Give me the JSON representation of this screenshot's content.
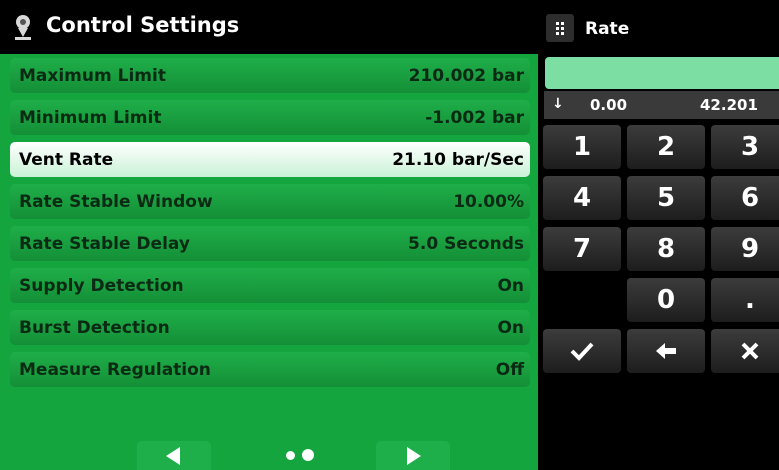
{
  "header": {
    "icon": "location-pin-icon",
    "title": "Control Settings"
  },
  "settings": [
    {
      "label": "Maximum Limit",
      "value": "210.002 bar",
      "selected": false
    },
    {
      "label": "Minimum Limit",
      "value": "-1.002 bar",
      "selected": false
    },
    {
      "label": "Vent Rate",
      "value": "21.10 bar/Sec",
      "selected": true
    },
    {
      "label": "Rate Stable Window",
      "value": "10.00%",
      "selected": false
    },
    {
      "label": "Rate Stable Delay",
      "value": "5.0 Seconds",
      "selected": false
    },
    {
      "label": "Supply Detection",
      "value": "On",
      "selected": false
    },
    {
      "label": "Burst Detection",
      "value": "On",
      "selected": false
    },
    {
      "label": "Measure Regulation",
      "value": "Off",
      "selected": false
    }
  ],
  "pager": {
    "pages": 2,
    "current": 2,
    "prev_icon": "arrow-left-icon",
    "next_icon": "arrow-right-icon"
  },
  "keypad": {
    "icon": "grid-icon",
    "title": "Rate",
    "entry_value": "",
    "range_icon": "down-arrow-icon",
    "range_min": "0.00",
    "range_max": "42.201",
    "keys": {
      "k1": "1",
      "k2": "2",
      "k3": "3",
      "k4": "4",
      "k5": "5",
      "k6": "6",
      "k7": "7",
      "k8": "8",
      "k9": "9",
      "k0": "0",
      "dot": "."
    },
    "action_icons": [
      "checkmark-icon",
      "backspace-arrow-icon",
      "close-x-icon"
    ]
  },
  "colors": {
    "panel_green": "#14a53f",
    "row_green": "#1fae49",
    "selected_row": "#ffffff",
    "entry_field": "#7ddea3",
    "keypad_key": "#2d2d2d"
  }
}
